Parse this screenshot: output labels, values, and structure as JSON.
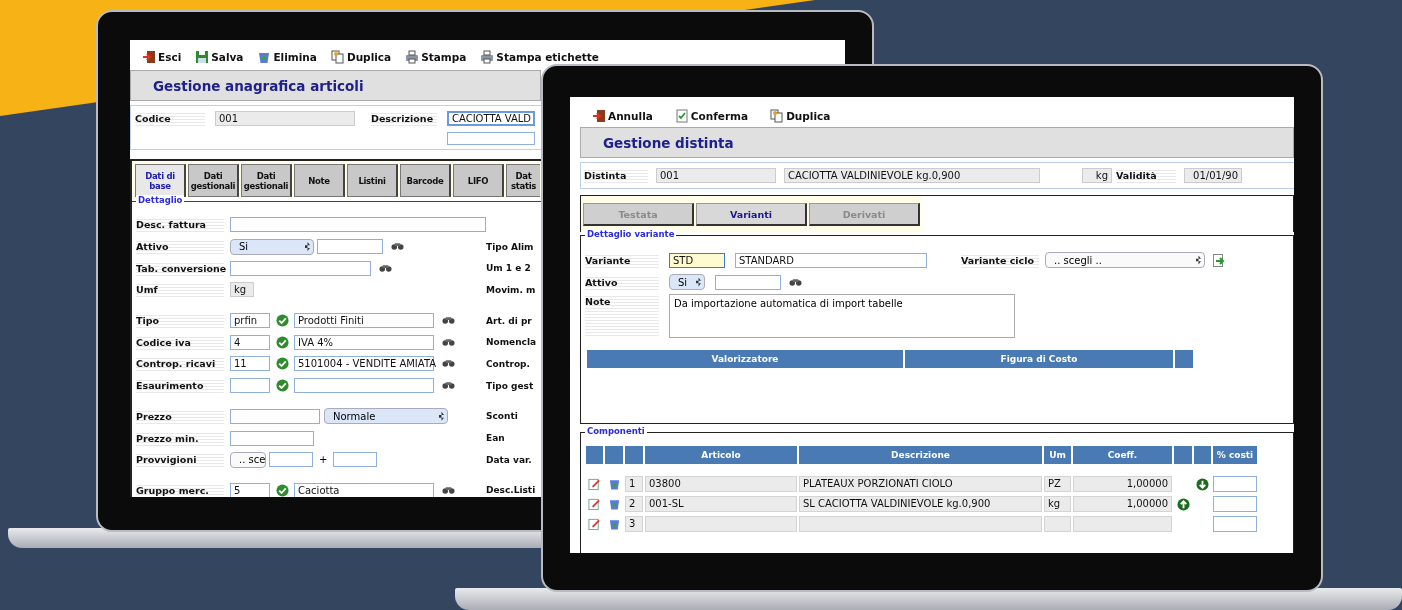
{
  "left_app": {
    "toolbar": [
      "Esci",
      "Salva",
      "Elimina",
      "Duplica",
      "Stampa",
      "Stampa etichette"
    ],
    "title": "Gestione anagrafica articoli",
    "codice": {
      "label": "Codice",
      "value": "001"
    },
    "descrizione": {
      "label": "Descrizione",
      "value": "CACIOTTA VALD"
    },
    "tabs": [
      {
        "label": "Dati di base",
        "selected": true
      },
      {
        "label": "Dati gestionali",
        "selected": false
      },
      {
        "label": "Dati gestionali",
        "selected": false
      },
      {
        "label": "Note",
        "selected": false
      },
      {
        "label": "Listini",
        "selected": false
      },
      {
        "label": "Barcode",
        "selected": false
      },
      {
        "label": "LIFO",
        "selected": false
      },
      {
        "label": "Dat statis",
        "selected": false
      }
    ],
    "section_title": "Dettaglio",
    "groups": [
      [
        {
          "kind": "wide",
          "label": "Desc. fattura"
        },
        {
          "kind": "select_lookup",
          "label": "Attivo",
          "select": "Si",
          "side_label": "Tipo Alim"
        },
        {
          "kind": "lookup",
          "label": "Tab. conversione",
          "side_label": "Um 1 e 2"
        },
        {
          "kind": "readonly",
          "label": "Umf",
          "value": "kg",
          "side_label": "Movim. m"
        }
      ],
      [
        {
          "kind": "coded",
          "label": "Tipo",
          "code": "prfin",
          "value": "Prodotti Finiti",
          "side_label": "Art. di pr"
        },
        {
          "kind": "coded",
          "label": "Codice iva",
          "code": "4",
          "value": "IVA 4%",
          "side_label": "Nomencla"
        },
        {
          "kind": "coded",
          "label": "Controp. ricavi",
          "code": "11",
          "value": "5101004 - VENDITE AMIATA",
          "side_label": "Controp."
        },
        {
          "kind": "coded",
          "label": "Esaurimento",
          "side_label": "Tipo gest"
        }
      ],
      [
        {
          "kind": "price",
          "label": "Prezzo",
          "select": "Normale",
          "side_label": "Sconti"
        },
        {
          "kind": "input",
          "label": "Prezzo min.",
          "side_label": "Ean"
        },
        {
          "kind": "commission",
          "label": "Provvigioni",
          "select": ".. sce",
          "joiner": "+",
          "side_label": "Data var."
        }
      ],
      [
        {
          "kind": "coded",
          "label": "Gruppo merc.",
          "code": "5",
          "value": "Caciotta",
          "side_label": "Desc.Listi"
        }
      ]
    ]
  },
  "right_app": {
    "toolbar": [
      "Annulla",
      "Conferma",
      "Duplica"
    ],
    "title": "Gestione distinta",
    "distinta": {
      "label": "Distinta",
      "code": "001",
      "description": "CACIOTTA VALDINIEVOLE kg.0,900",
      "unit": "kg",
      "validity_label": "Validità",
      "validity": "01/01/90"
    },
    "tabs": [
      {
        "label": "Testata",
        "selected": false
      },
      {
        "label": "Varianti",
        "selected": true
      },
      {
        "label": "Derivati",
        "selected": false
      }
    ],
    "variant": {
      "legend": "Dettaglio variante",
      "label": "Variante",
      "code": "STD",
      "code_focused": true,
      "name": "STANDARD",
      "cycle_label": "Variante ciclo",
      "cycle_select": ".. scegli ..",
      "active_label": "Attivo",
      "active_select": "Si",
      "note_label": "Note",
      "note": "Da importazione automatica di import tabelle"
    },
    "cost_columns": [
      "Valorizzatore",
      "Figura di Costo"
    ],
    "components": {
      "legend": "Componenti",
      "columns": [
        "Articolo",
        "Descrizione",
        "Um",
        "Coeff.",
        "% costi"
      ],
      "rows": [
        {
          "n": "1",
          "article": "03800",
          "description": "PLATEAUX PORZIONATI CIOLO",
          "unit": "PZ",
          "coeff": "1,00000",
          "kind": "move_down"
        },
        {
          "n": "2",
          "article": "001-SL",
          "description": "SL CACIOTTA VALDINIEVOLE kg.0,900",
          "unit": "kg",
          "coeff": "1,00000",
          "kind": "move_up"
        },
        {
          "n": "3"
        }
      ]
    }
  }
}
